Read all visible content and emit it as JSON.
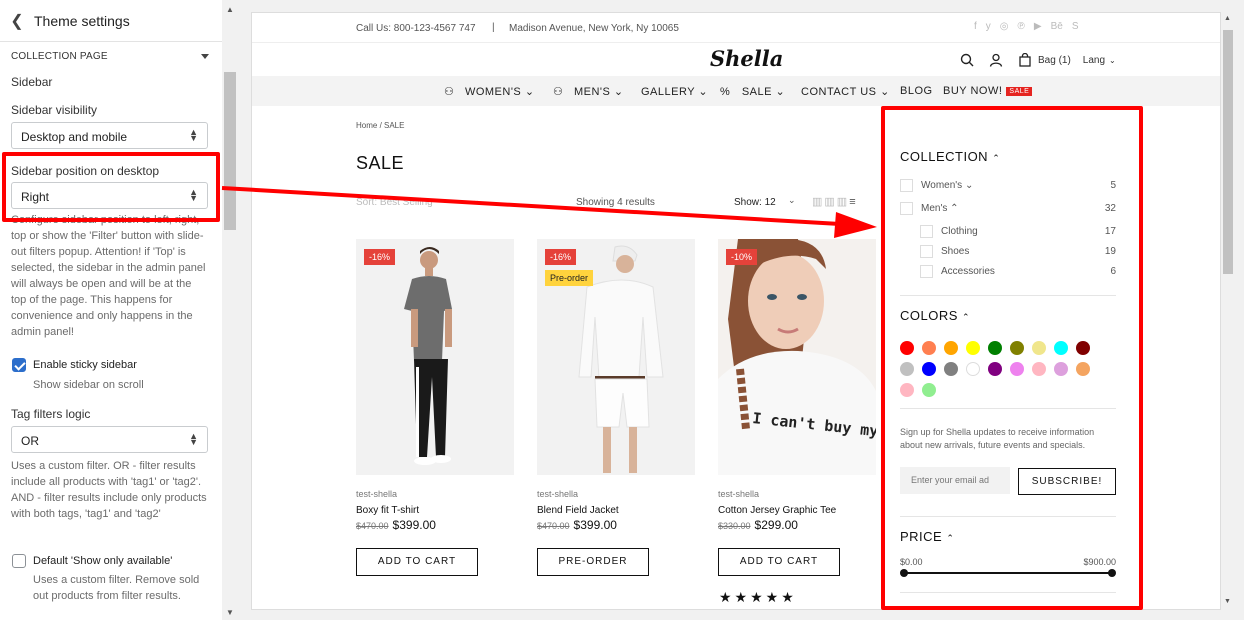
{
  "editor": {
    "title": "Theme settings",
    "section": "COLLECTION PAGE",
    "group": "Sidebar",
    "visibility_label": "Sidebar visibility",
    "visibility_value": "Desktop and mobile",
    "position_label": "Sidebar position on desktop",
    "position_value": "Right",
    "position_help": "Configure sidebar position to left, right, top or show the 'Filter' button with slide-out filters popup. Attention! if 'Top' is selected, the sidebar in the admin panel will always be open and will be at the top of the page. This happens for convenience and only happens in the admin panel!",
    "sticky_label": "Enable sticky sidebar",
    "sticky_sub": "Show sidebar on scroll",
    "sticky_checked": true,
    "tag_logic_label": "Tag filters logic",
    "tag_logic_value": "OR",
    "tag_logic_help": "Uses a custom filter. OR - filter results include all products with 'tag1' or 'tag2'. AND - filter results include only products with both tags, 'tag1' and 'tag2'",
    "available_label": "Default 'Show only available'",
    "available_sub": "Uses a custom filter. Remove sold out products from filter results.",
    "available_checked": false
  },
  "store": {
    "contact": "Call Us: 800-123-4567 747",
    "separator": "|",
    "address": "Madison Avenue, New York, Ny 10065",
    "socials": [
      "f",
      "y",
      "◎",
      "℗",
      "▶",
      "Bē",
      "S"
    ],
    "logo": "Shella",
    "bag": "Bag (1)",
    "lang": "Lang",
    "nav": [
      {
        "label": "WOMEN'S",
        "icon": "woman-icon",
        "dropdown": true
      },
      {
        "label": "MEN'S",
        "icon": "man-icon",
        "dropdown": true
      },
      {
        "label": "GALLERY",
        "dropdown": true
      },
      {
        "label": "SALE",
        "icon": "percent-icon",
        "dropdown": true
      },
      {
        "label": "CONTACT US",
        "dropdown": true
      },
      {
        "label": "BLOG"
      },
      {
        "label": "BUY NOW!",
        "badge": "SALE"
      }
    ],
    "breadcrumb": "Home / SALE",
    "page_title": "SALE",
    "sort_label": "Sort: Best Selling",
    "results": "Showing 4 results",
    "show": "Show: 12",
    "products": [
      {
        "vendor": "test-shella",
        "name": "Boxy fit T-shirt",
        "old_price": "$470.00",
        "price": "$399.00",
        "badges": [
          "-16%"
        ],
        "button": "ADD TO CART"
      },
      {
        "vendor": "test-shella",
        "name": "Blend Field Jacket",
        "old_price": "$470.00",
        "price": "$399.00",
        "badges": [
          "-16%",
          "Pre-order"
        ],
        "button": "PRE-ORDER"
      },
      {
        "vendor": "test-shella",
        "name": "Cotton Jersey Graphic Tee",
        "old_price": "$330.00",
        "price": "$299.00",
        "badges": [
          "-10%"
        ],
        "button": "ADD TO CART"
      }
    ],
    "rating": "★★★★★",
    "tee_print": "I can't buy my love."
  },
  "filters": {
    "collection_title": "COLLECTION",
    "collections": [
      {
        "label": "Women's",
        "count": "5",
        "level": 0,
        "dropdown": true
      },
      {
        "label": "Men's",
        "count": "32",
        "level": 0,
        "expanded": true
      },
      {
        "label": "Clothing",
        "count": "17",
        "level": 1
      },
      {
        "label": "Shoes",
        "count": "19",
        "level": 1
      },
      {
        "label": "Accessories",
        "count": "6",
        "level": 1
      }
    ],
    "colors_title": "COLORS",
    "colors": [
      "#ff0000",
      "#ff7f50",
      "#ffa500",
      "#ffff00",
      "#008000",
      "#808000",
      "#f0e68c",
      "#00ffff",
      "#800000",
      "#c0c0c0",
      "#0000ff",
      "#808080",
      "#ffffff",
      "#800080",
      "#ee82ee",
      "#ffb6c1",
      "#dda0dd",
      "#f4a460",
      "#ffb6c1",
      "#90ee90"
    ],
    "signup": "Sign up for Shella updates to receive information about new arrivals, future events and specials.",
    "email_placeholder": "Enter your email ad",
    "subscribe": "SUBSCRIBE!",
    "price_title": "PRICE",
    "price_min": "$0.00",
    "price_max": "$900.00"
  }
}
